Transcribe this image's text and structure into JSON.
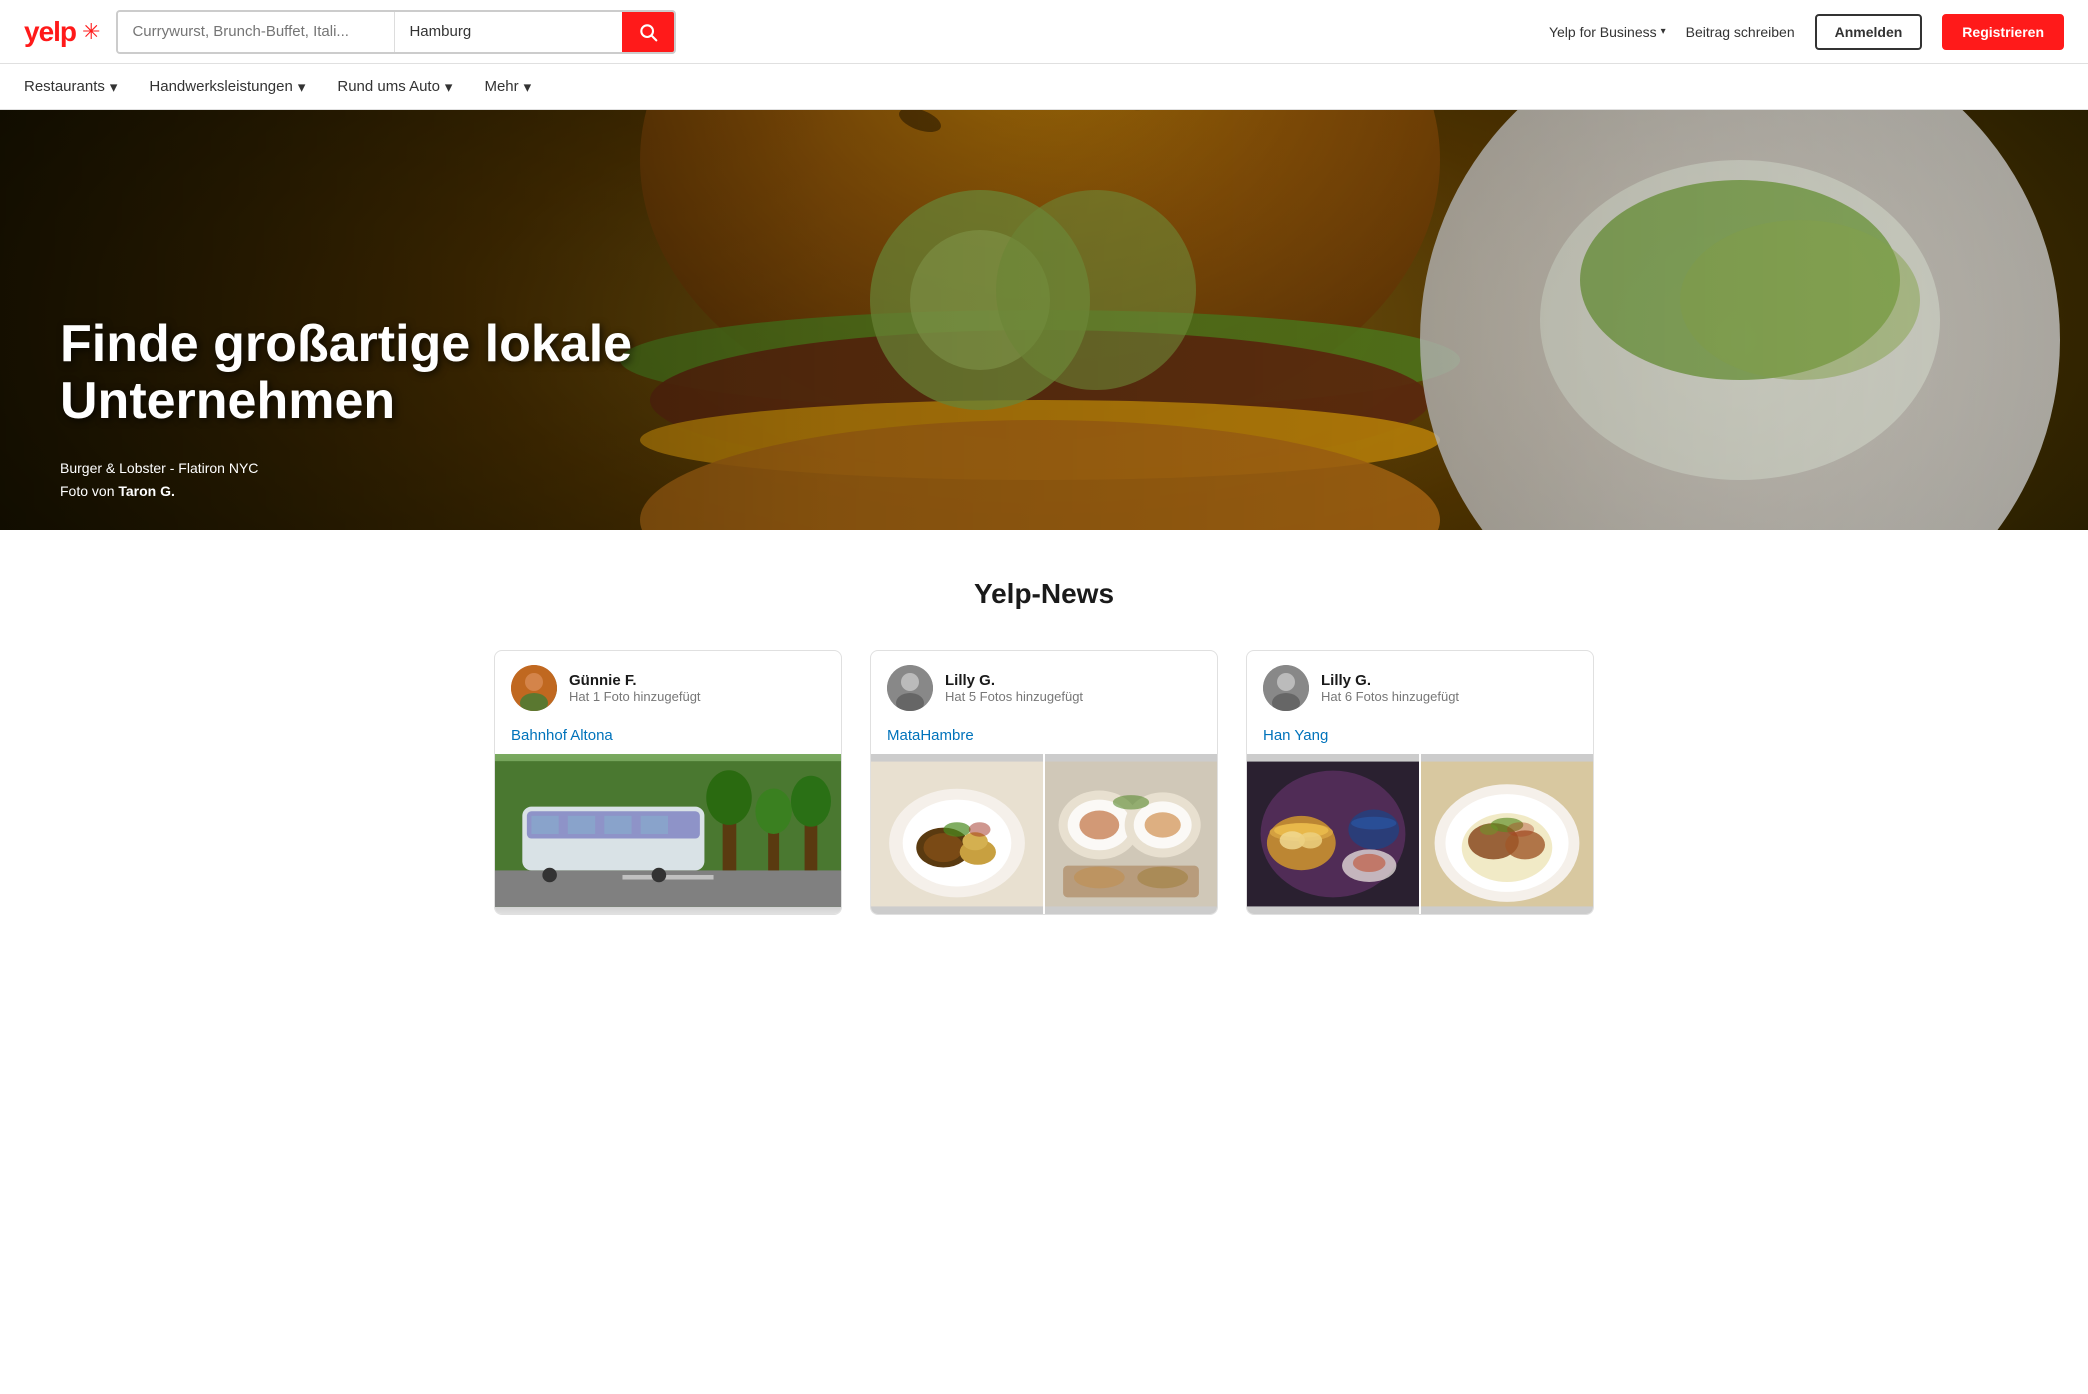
{
  "header": {
    "logo": "yelp",
    "logo_burst": "✳",
    "search_placeholder_what": "Currywurst, Brunch-Buffet, Itali...",
    "search_placeholder_where": "Hamburg",
    "search_icon": "🔍",
    "nav": {
      "yelp_for_business": "Yelp for Business",
      "yelp_for_business_chevron": "▾",
      "beitrag_schreiben": "Beitrag schreiben",
      "anmelden": "Anmelden",
      "registrieren": "Registrieren"
    }
  },
  "sub_nav": {
    "items": [
      {
        "label": "Restaurants",
        "has_chevron": true
      },
      {
        "label": "Handwerksleistungen",
        "has_chevron": true
      },
      {
        "label": "Rund ums Auto",
        "has_chevron": true
      },
      {
        "label": "Mehr",
        "has_chevron": true
      }
    ]
  },
  "hero": {
    "title": "Finde großartige lokale Unternehmen",
    "caption_line1": "Burger & Lobster - Flatiron NYC",
    "caption_line2_prefix": "Foto von ",
    "caption_author": "Taron G."
  },
  "section": {
    "title": "Yelp-News"
  },
  "news_cards": [
    {
      "user_name": "Günnie F.",
      "user_action": "Hat 1 Foto hinzugefügt",
      "business_name": "Bahnhof Altona",
      "avatar_type": "gunnie",
      "images": [
        "train"
      ],
      "image_layout": "single"
    },
    {
      "user_name": "Lilly G.",
      "user_action": "Hat 5 Fotos hinzugefügt",
      "business_name": "MataHambre",
      "avatar_type": "lilly",
      "images": [
        "food1",
        "food2"
      ],
      "image_layout": "double"
    },
    {
      "user_name": "Lilly G.",
      "user_action": "Hat 6 Fotos hinzugefügt",
      "business_name": "Han Yang",
      "avatar_type": "lilly",
      "images": [
        "asian1",
        "asian2"
      ],
      "image_layout": "double"
    }
  ]
}
